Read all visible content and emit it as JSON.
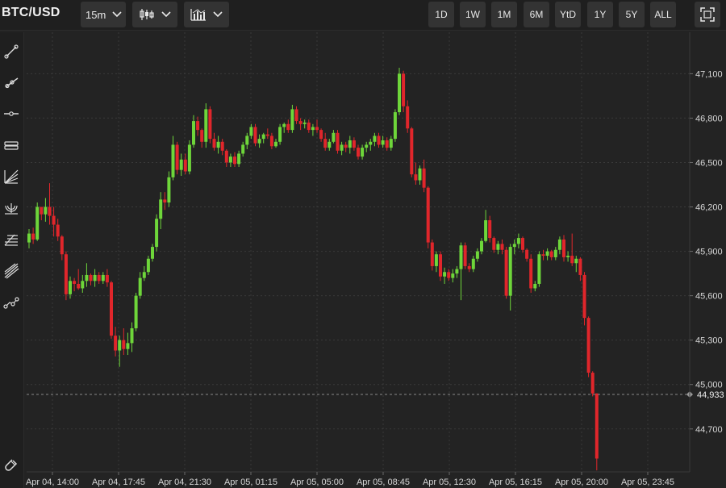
{
  "toolbar": {
    "symbol": "BTC/USD",
    "interval": "15m",
    "ranges": [
      "1D",
      "1W",
      "1M",
      "6M",
      "YtD",
      "1Y",
      "5Y",
      "ALL"
    ]
  },
  "tools": [
    "trend-line-icon",
    "ray-line-icon",
    "horizontal-line-icon",
    "parallel-channel-icon",
    "fib-fan-icon",
    "fib-arcs-icon",
    "fib-retracement-icon",
    "pitchfork-icon",
    "path-tool-icon"
  ],
  "chart_data": {
    "type": "candlestick",
    "x_labels": [
      "Apr 04, 14:00",
      "Apr 04, 17:45",
      "Apr 04, 21:30",
      "Apr 05, 01:15",
      "Apr 05, 05:00",
      "Apr 05, 08:45",
      "Apr 05, 12:30",
      "Apr 05, 16:15",
      "Apr 05, 20:00",
      "Apr 05, 23:45"
    ],
    "y_ticks": [
      44700,
      45000,
      45300,
      45600,
      45900,
      46200,
      46500,
      46800,
      47100
    ],
    "y_tick_labels": [
      "44,700",
      "45,000",
      "45,300",
      "45,600",
      "45,900",
      "46,200",
      "46,500",
      "46,800",
      "47,100"
    ],
    "ylim": [
      44410,
      47380
    ],
    "current_price": 44933,
    "current_price_label": "44,933",
    "up_color": "#6ed63a",
    "down_color": "#e0262b",
    "candles": [
      [
        45960,
        46050,
        45920,
        46020
      ],
      [
        46020,
        46060,
        45950,
        45980
      ],
      [
        45980,
        46230,
        45970,
        46200
      ],
      [
        46200,
        46180,
        46110,
        46150
      ],
      [
        46150,
        46260,
        46100,
        46200
      ],
      [
        46200,
        46360,
        46080,
        46140
      ],
      [
        46140,
        46200,
        46000,
        46080
      ],
      [
        46080,
        46120,
        45970,
        46000
      ],
      [
        46000,
        46010,
        45840,
        45880
      ],
      [
        45880,
        45900,
        45570,
        45610
      ],
      [
        45610,
        45730,
        45580,
        45700
      ],
      [
        45700,
        45720,
        45630,
        45680
      ],
      [
        45680,
        45780,
        45640,
        45650
      ],
      [
        45650,
        45740,
        45620,
        45700
      ],
      [
        45700,
        45820,
        45660,
        45740
      ],
      [
        45740,
        45750,
        45670,
        45700
      ],
      [
        45700,
        45780,
        45660,
        45740
      ],
      [
        45740,
        45760,
        45680,
        45700
      ],
      [
        45700,
        45760,
        45680,
        45740
      ],
      [
        45740,
        45780,
        45660,
        45690
      ],
      [
        45690,
        45700,
        45310,
        45330
      ],
      [
        45330,
        45390,
        45190,
        45230
      ],
      [
        45230,
        45330,
        45120,
        45300
      ],
      [
        45300,
        45380,
        45200,
        45240
      ],
      [
        45240,
        45350,
        45200,
        45280
      ],
      [
        45280,
        45420,
        45220,
        45380
      ],
      [
        45380,
        45620,
        45360,
        45600
      ],
      [
        45600,
        45760,
        45580,
        45720
      ],
      [
        45720,
        45800,
        45700,
        45760
      ],
      [
        45760,
        45870,
        45740,
        45850
      ],
      [
        45850,
        45950,
        45830,
        45930
      ],
      [
        45930,
        46150,
        45900,
        46120
      ],
      [
        46120,
        46300,
        46050,
        46250
      ],
      [
        46250,
        46300,
        46180,
        46230
      ],
      [
        46230,
        46440,
        46200,
        46400
      ],
      [
        46400,
        46680,
        46380,
        46620
      ],
      [
        46620,
        46640,
        46420,
        46450
      ],
      [
        46450,
        46560,
        46410,
        46520
      ],
      [
        46520,
        46560,
        46420,
        46440
      ],
      [
        46440,
        46650,
        46420,
        46620
      ],
      [
        46620,
        46820,
        46600,
        46780
      ],
      [
        46780,
        46810,
        46680,
        46720
      ],
      [
        46720,
        46730,
        46600,
        46640
      ],
      [
        46640,
        46900,
        46600,
        46860
      ],
      [
        46860,
        46880,
        46630,
        46660
      ],
      [
        46660,
        46700,
        46580,
        46600
      ],
      [
        46600,
        46680,
        46560,
        46640
      ],
      [
        46640,
        46660,
        46550,
        46580
      ],
      [
        46580,
        46590,
        46470,
        46500
      ],
      [
        46500,
        46560,
        46470,
        46540
      ],
      [
        46540,
        46570,
        46470,
        46490
      ],
      [
        46490,
        46580,
        46470,
        46560
      ],
      [
        46560,
        46640,
        46540,
        46620
      ],
      [
        46620,
        46700,
        46590,
        46680
      ],
      [
        46680,
        46760,
        46660,
        46740
      ],
      [
        46740,
        46760,
        46610,
        46630
      ],
      [
        46630,
        46690,
        46600,
        46660
      ],
      [
        46660,
        46700,
        46630,
        46690
      ],
      [
        46690,
        46730,
        46660,
        46680
      ],
      [
        46680,
        46700,
        46590,
        46610
      ],
      [
        46610,
        46660,
        46600,
        46640
      ],
      [
        46640,
        46760,
        46620,
        46740
      ],
      [
        46740,
        46770,
        46700,
        46760
      ],
      [
        46760,
        46790,
        46700,
        46720
      ],
      [
        46720,
        46890,
        46700,
        46860
      ],
      [
        46860,
        46880,
        46760,
        46780
      ],
      [
        46780,
        46800,
        46720,
        46760
      ],
      [
        46760,
        46790,
        46730,
        46770
      ],
      [
        46770,
        46790,
        46700,
        46720
      ],
      [
        46720,
        46760,
        46680,
        46740
      ],
      [
        46740,
        46790,
        46700,
        46720
      ],
      [
        46720,
        46730,
        46640,
        46660
      ],
      [
        46660,
        46700,
        46580,
        46600
      ],
      [
        46600,
        46660,
        46580,
        46640
      ],
      [
        46640,
        46720,
        46630,
        46700
      ],
      [
        46700,
        46720,
        46560,
        46580
      ],
      [
        46580,
        46640,
        46550,
        46620
      ],
      [
        46620,
        46640,
        46570,
        46600
      ],
      [
        46600,
        46680,
        46560,
        46650
      ],
      [
        46650,
        46670,
        46580,
        46600
      ],
      [
        46600,
        46620,
        46520,
        46540
      ],
      [
        46540,
        46620,
        46520,
        46600
      ],
      [
        46600,
        46640,
        46570,
        46620
      ],
      [
        46620,
        46660,
        46580,
        46640
      ],
      [
        46640,
        46700,
        46610,
        46680
      ],
      [
        46680,
        46700,
        46600,
        46620
      ],
      [
        46620,
        46680,
        46600,
        46650
      ],
      [
        46650,
        46670,
        46580,
        46600
      ],
      [
        46600,
        46680,
        46580,
        46660
      ],
      [
        46660,
        46860,
        46640,
        46840
      ],
      [
        46840,
        47140,
        46820,
        47100
      ],
      [
        47100,
        47120,
        46840,
        46880
      ],
      [
        46880,
        46920,
        46700,
        46730
      ],
      [
        46730,
        46740,
        46400,
        46420
      ],
      [
        46420,
        46500,
        46350,
        46380
      ],
      [
        46380,
        46480,
        46350,
        46460
      ],
      [
        46460,
        46520,
        46300,
        46330
      ],
      [
        46330,
        46340,
        45920,
        45960
      ],
      [
        45960,
        45980,
        45770,
        45800
      ],
      [
        45800,
        45900,
        45760,
        45880
      ],
      [
        45880,
        45900,
        45700,
        45730
      ],
      [
        45730,
        45790,
        45680,
        45760
      ],
      [
        45760,
        45780,
        45700,
        45720
      ],
      [
        45720,
        45780,
        45690,
        45750
      ],
      [
        45750,
        45800,
        45720,
        45780
      ],
      [
        45780,
        45960,
        45570,
        45940
      ],
      [
        45940,
        45960,
        45780,
        45800
      ],
      [
        45800,
        45820,
        45760,
        45780
      ],
      [
        45780,
        45870,
        45760,
        45850
      ],
      [
        45850,
        45920,
        45830,
        45900
      ],
      [
        45900,
        45990,
        45880,
        45970
      ],
      [
        45970,
        46180,
        45960,
        46110
      ],
      [
        46110,
        46140,
        45960,
        45990
      ],
      [
        45990,
        46000,
        45890,
        45910
      ],
      [
        45910,
        45970,
        45880,
        45950
      ],
      [
        45950,
        45980,
        45880,
        45910
      ],
      [
        45910,
        45930,
        45580,
        45600
      ],
      [
        45600,
        45950,
        45500,
        45930
      ],
      [
        45930,
        45980,
        45880,
        45950
      ],
      [
        45950,
        46020,
        45920,
        45990
      ],
      [
        45990,
        46000,
        45890,
        45910
      ],
      [
        45910,
        45920,
        45830,
        45850
      ],
      [
        45850,
        45880,
        45620,
        45650
      ],
      [
        45650,
        45700,
        45630,
        45680
      ],
      [
        45680,
        45900,
        45660,
        45880
      ],
      [
        45880,
        45910,
        45840,
        45870
      ],
      [
        45870,
        45920,
        45840,
        45900
      ],
      [
        45900,
        45910,
        45840,
        45860
      ],
      [
        45860,
        45930,
        45840,
        45910
      ],
      [
        45910,
        46000,
        45880,
        45980
      ],
      [
        45980,
        46010,
        45830,
        45860
      ],
      [
        45860,
        45900,
        45830,
        45870
      ],
      [
        45870,
        46020,
        45800,
        45820
      ],
      [
        45820,
        45870,
        45760,
        45850
      ],
      [
        45850,
        45860,
        45700,
        45740
      ],
      [
        45740,
        45760,
        45400,
        45450
      ],
      [
        45450,
        45460,
        45050,
        45080
      ],
      [
        45080,
        45090,
        44920,
        44940
      ],
      [
        44940,
        44940,
        44420,
        44500
      ]
    ]
  }
}
